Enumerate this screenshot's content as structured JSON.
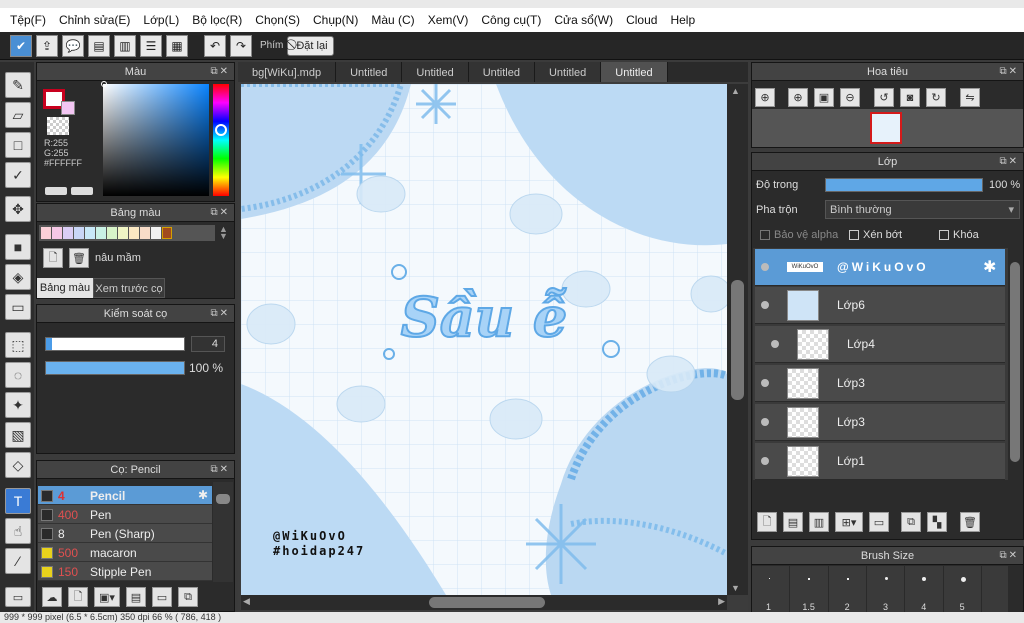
{
  "menu": [
    "Tệp(F)",
    "Chỉnh sửa(E)",
    "Lớp(L)",
    "Bộ lọc(R)",
    "Chọn(S)",
    "Chụp(N)",
    "Màu (C)",
    "Xem(V)",
    "Công cụ(T)",
    "Cửa sổ(W)",
    "Cloud",
    "Help"
  ],
  "toolbar": {
    "phim_label": "Phím",
    "reset_label": "Đặt lại"
  },
  "color_panel": {
    "title": "Màu",
    "r": "R:255",
    "g": "G:255",
    "hex": "#FFFFFF"
  },
  "palette_panel": {
    "title": "Bảng màu",
    "color_name": "nâu mầm",
    "tab_palette": "Bảng màu",
    "tab_preview": "Xem trước cọ"
  },
  "brush_control": {
    "title": "Kiểm soát cọ",
    "size": "4",
    "opacity": "100 %",
    "size_fraction": 0.02,
    "opacity_fraction": 1.0
  },
  "brush_panel": {
    "title": "Cọ: Pencil",
    "items": [
      {
        "size": "4",
        "name": "Pencil",
        "color": "#2a2a2a",
        "selected": true
      },
      {
        "size": "400",
        "name": "Pen",
        "color": "#2a2a2a"
      },
      {
        "size": "8",
        "name": "Pen (Sharp)",
        "color": "#2a2a2a"
      },
      {
        "size": "500",
        "name": "macaron",
        "color": "#e8d21c"
      },
      {
        "size": "150",
        "name": "Stipple Pen",
        "color": "#e8d21c"
      }
    ]
  },
  "tabs": [
    "bg[WiKu].mdp",
    "Untitled",
    "Untitled",
    "Untitled",
    "Untitled",
    "Untitled"
  ],
  "canvas": {
    "title": "Sầu ễ",
    "credit1": "@WiKuOvO",
    "credit2": "#hoidap247"
  },
  "navigator": {
    "title": "Hoa tiêu"
  },
  "layers_panel": {
    "title": "Lớp",
    "opacity_label": "Độ trong",
    "opacity_value": "100 %",
    "opacity_fraction": 1.0,
    "blend_label": "Pha trộn",
    "blend_value": "Bình thường",
    "protect_alpha": "Bảo vệ alpha",
    "clipping": "Xén bớt",
    "lock": "Khóa",
    "layers": [
      {
        "name": "@WiKuOvO",
        "selected": true
      },
      {
        "name": "Lớp6"
      },
      {
        "name": "Lớp4"
      },
      {
        "name": "Lớp3"
      },
      {
        "name": "Lớp3"
      },
      {
        "name": "Lớp1"
      }
    ]
  },
  "brush_size": {
    "title": "Brush Size",
    "sizes": [
      "1",
      "1.5",
      "2",
      "3",
      "4",
      "5"
    ]
  },
  "status": "999 * 999 pixel  (6.5 * 6.5cm)  350 dpi  66 %  ( 786, 418 )",
  "accent": "#5b9bd6"
}
